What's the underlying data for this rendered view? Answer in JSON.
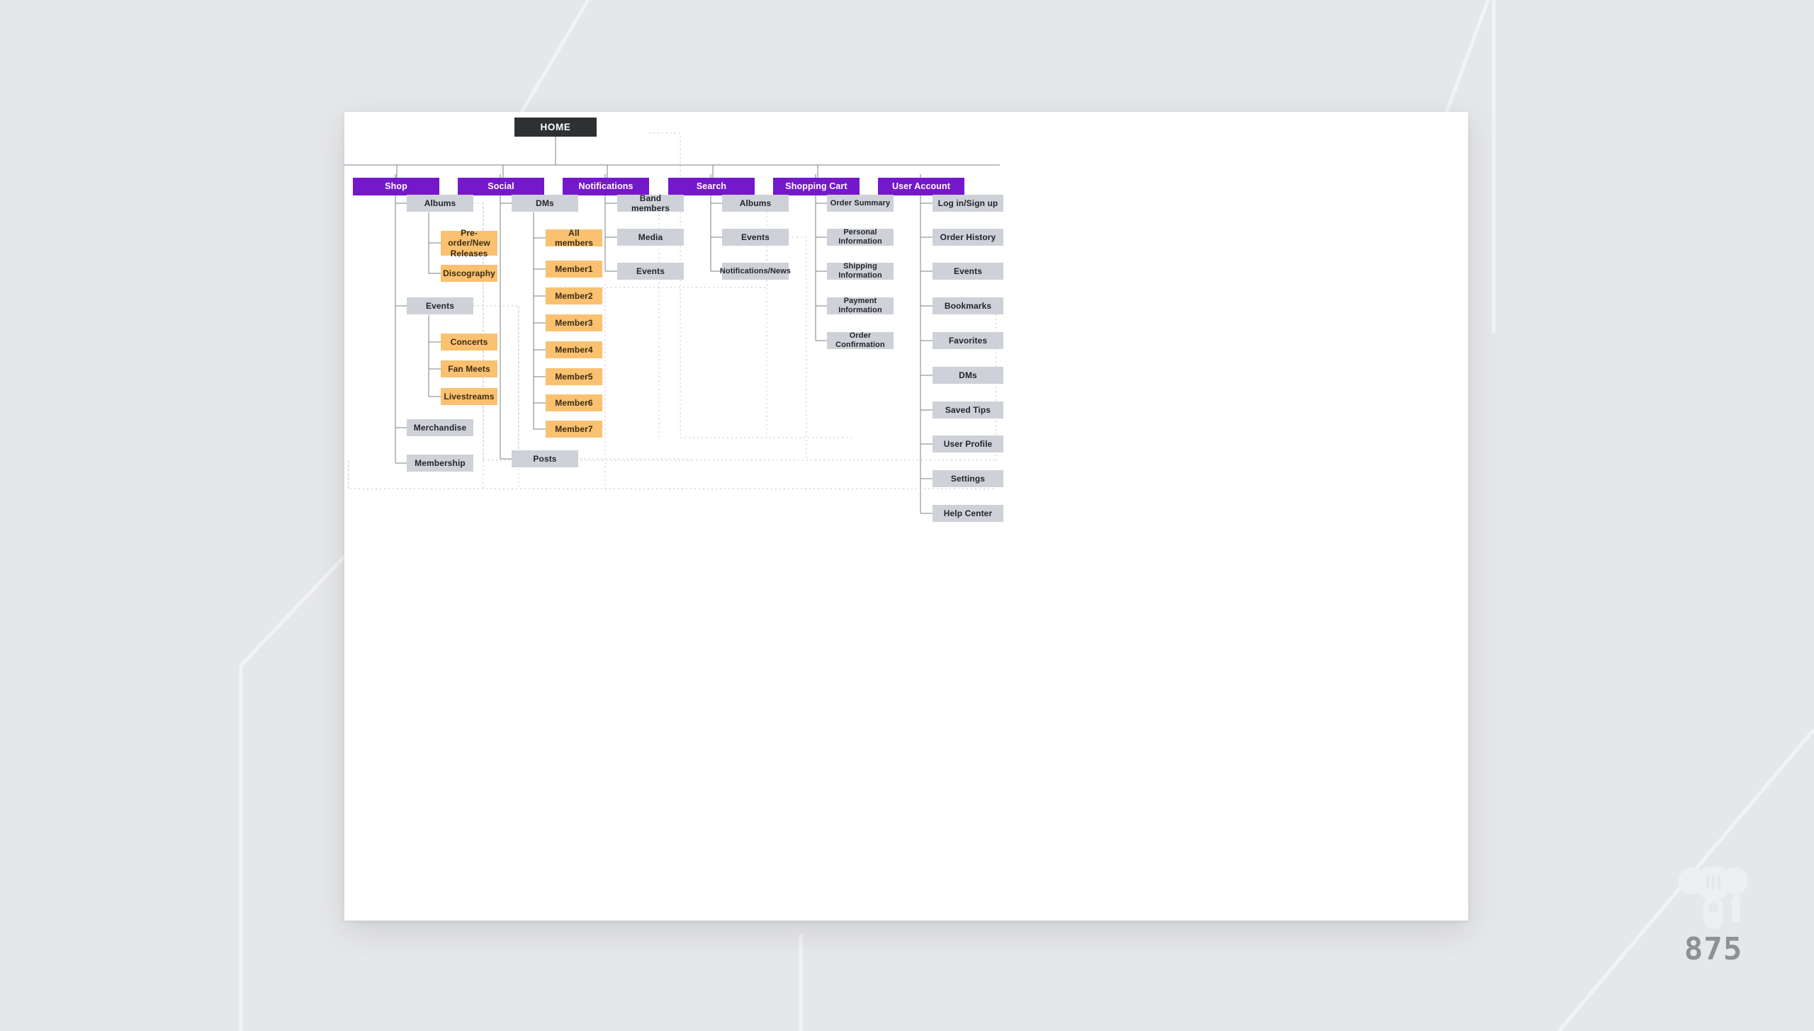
{
  "canvas": {
    "background_color": "#e6e7e9",
    "board_color": "#ffffff"
  },
  "palette": {
    "root": "#2e3033",
    "level1": "#7518cc",
    "level2": "#ced1d7",
    "level3": "#f9c170",
    "connector": "#7b7f86",
    "dotted_connector": "#c3c6cb"
  },
  "root": {
    "label": "HOME"
  },
  "branches": [
    {
      "label": "Shop",
      "children": [
        {
          "label": "Albums",
          "children": [
            {
              "label": "Pre-order/New Releases"
            },
            {
              "label": "Discography"
            }
          ]
        },
        {
          "label": "Events",
          "children": [
            {
              "label": "Concerts"
            },
            {
              "label": "Fan Meets"
            },
            {
              "label": "Livestreams"
            }
          ]
        },
        {
          "label": "Merchandise"
        },
        {
          "label": "Membership"
        }
      ]
    },
    {
      "label": "Social",
      "children": [
        {
          "label": "DMs",
          "children": [
            {
              "label": "All members"
            },
            {
              "label": "Member1"
            },
            {
              "label": "Member2"
            },
            {
              "label": "Member3"
            },
            {
              "label": "Member4"
            },
            {
              "label": "Member5"
            },
            {
              "label": "Member6"
            },
            {
              "label": "Member7"
            }
          ]
        },
        {
          "label": "Posts"
        }
      ]
    },
    {
      "label": "Notifications",
      "children": [
        {
          "label": "Band members"
        },
        {
          "label": "Media"
        },
        {
          "label": "Events"
        }
      ]
    },
    {
      "label": "Search",
      "children": [
        {
          "label": "Albums"
        },
        {
          "label": "Events"
        },
        {
          "label": "Notifications/News"
        }
      ]
    },
    {
      "label": "Shopping Cart",
      "children": [
        {
          "label": "Order Summary"
        },
        {
          "label": "Personal Information"
        },
        {
          "label": "Shipping Information"
        },
        {
          "label": "Payment Information"
        },
        {
          "label": "Order Confirmation"
        }
      ]
    },
    {
      "label": "User Account",
      "children": [
        {
          "label": "Log in/Sign up"
        },
        {
          "label": "Order History"
        },
        {
          "label": "Events"
        },
        {
          "label": "Bookmarks"
        },
        {
          "label": "Favorites"
        },
        {
          "label": "DMs"
        },
        {
          "label": "Saved Tips"
        },
        {
          "label": "User Profile"
        },
        {
          "label": "Settings"
        },
        {
          "label": "Help Center"
        }
      ]
    }
  ],
  "logo": {
    "number": "875"
  }
}
